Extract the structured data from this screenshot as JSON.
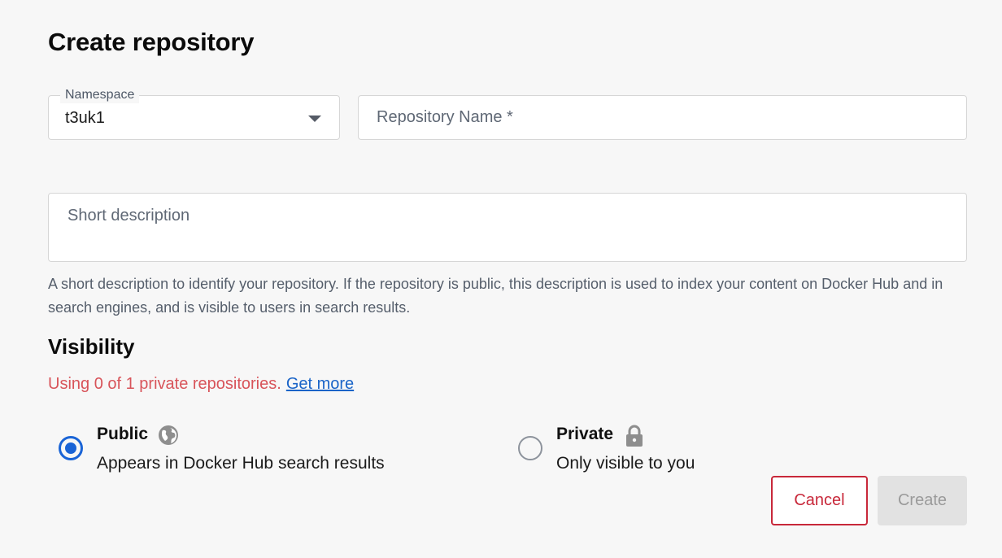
{
  "page": {
    "title": "Create repository"
  },
  "namespace": {
    "label": "Namespace",
    "value": "t3uk1",
    "icon": "chevron-down-icon"
  },
  "repository_name": {
    "placeholder": "Repository Name *",
    "value": ""
  },
  "short_description": {
    "placeholder": "Short description",
    "value": "",
    "helper": "A short description to identify your repository. If the repository is public, this description is used to index your content on Docker Hub and in search engines, and is visible to users in search results."
  },
  "visibility": {
    "title": "Visibility",
    "usage_text": "Using 0 of 1 private repositories.",
    "usage_link": "Get more",
    "options": [
      {
        "label": "Public",
        "description": "Appears in Docker Hub search results",
        "icon": "globe-icon",
        "selected": true
      },
      {
        "label": "Private",
        "description": "Only visible to you",
        "icon": "lock-icon",
        "selected": false
      }
    ]
  },
  "actions": {
    "cancel_label": "Cancel",
    "create_label": "Create"
  },
  "colors": {
    "accent": "#1a64d6",
    "danger": "#c8283a",
    "usage_text": "#d8545a",
    "link": "#1a64c8",
    "disabled_bg": "#e2e2e2"
  }
}
